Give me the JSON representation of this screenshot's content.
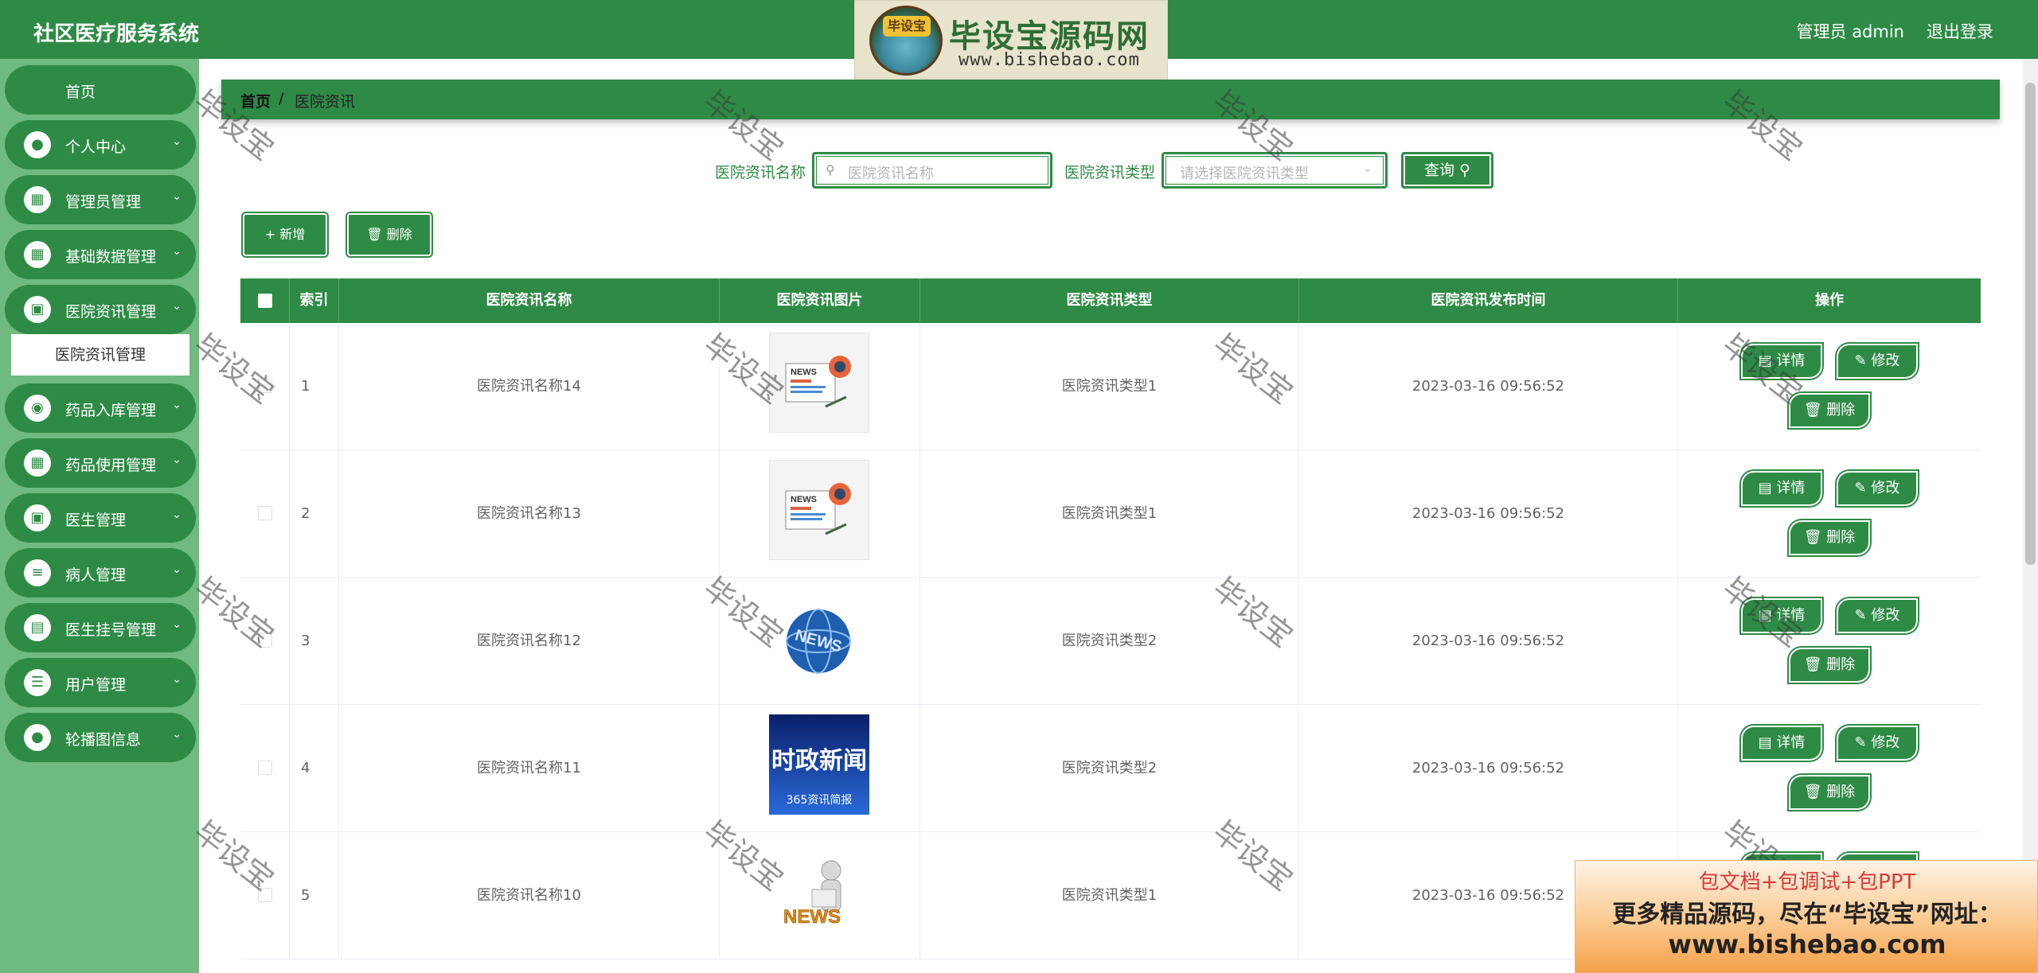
{
  "header": {
    "app_title": "社区医疗服务系统",
    "user_info": "管理员 admin",
    "logout_label": "退出登录"
  },
  "logo": {
    "badge_text": "毕设宝",
    "title": "毕设宝源码网",
    "url": "www.bishebao.com"
  },
  "sidebar": {
    "items": [
      {
        "label": "首页",
        "icon": "home-icon"
      },
      {
        "label": "个人中心",
        "icon": "user-icon"
      },
      {
        "label": "管理员管理",
        "icon": "grid-icon"
      },
      {
        "label": "基础数据管理",
        "icon": "grid-icon"
      },
      {
        "label": "医院资讯管理",
        "icon": "wallet-icon"
      },
      {
        "label": "药品入库管理",
        "icon": "location-icon"
      },
      {
        "label": "药品使用管理",
        "icon": "grid-icon"
      },
      {
        "label": "医生管理",
        "icon": "briefcase-icon"
      },
      {
        "label": "病人管理",
        "icon": "sliders-icon"
      },
      {
        "label": "医生挂号管理",
        "icon": "clipboard-icon"
      },
      {
        "label": "用户管理",
        "icon": "list-icon"
      },
      {
        "label": "轮播图信息",
        "icon": "user-icon"
      }
    ],
    "submenu_active": "医院资讯管理"
  },
  "breadcrumb": {
    "home": "首页",
    "separator": "/",
    "current": "医院资讯"
  },
  "search": {
    "name_label": "医院资讯名称",
    "name_placeholder": "医院资讯名称",
    "type_label": "医院资讯类型",
    "type_placeholder": "请选择医院资讯类型",
    "query_label": "查询"
  },
  "actions": {
    "add_label": "新增",
    "delete_label": "删除"
  },
  "table": {
    "columns": [
      "索引",
      "医院资讯名称",
      "医院资讯图片",
      "医院资讯类型",
      "医院资讯发布时间",
      "操作"
    ],
    "rows": [
      {
        "index": "1",
        "name": "医院资讯名称14",
        "type": "医院资讯类型1",
        "time": "2023-03-16 09:56:52",
        "image": "news-paper"
      },
      {
        "index": "2",
        "name": "医院资讯名称13",
        "type": "医院资讯类型1",
        "time": "2023-03-16 09:56:52",
        "image": "news-paper"
      },
      {
        "index": "3",
        "name": "医院资讯名称12",
        "type": "医院资讯类型2",
        "time": "2023-03-16 09:56:52",
        "image": "news-globe"
      },
      {
        "index": "4",
        "name": "医院资讯名称11",
        "type": "医院资讯类型2",
        "time": "2023-03-16 09:56:52",
        "image": "news-politics"
      },
      {
        "index": "5",
        "name": "医院资讯名称10",
        "type": "医院资讯类型1",
        "time": "2023-03-16 09:56:52",
        "image": "news-figure"
      }
    ],
    "op_labels": {
      "detail": "详情",
      "edit": "修改",
      "delete": "删除"
    },
    "thumb_text": {
      "news": "NEWS",
      "politics_title": "时政新闻",
      "politics_sub": "365资讯简报"
    }
  },
  "watermark_text": "毕设宝",
  "promo": {
    "top": "包文档+包调试+包PPT",
    "middle": "更多精品源码，尽在“毕设宝”网址：",
    "url": "www.bishebao.com"
  },
  "colors": {
    "primary": "#2e8b45",
    "sidebar_bg": "#6fbb7f",
    "promo_red": "#d83a3a"
  }
}
